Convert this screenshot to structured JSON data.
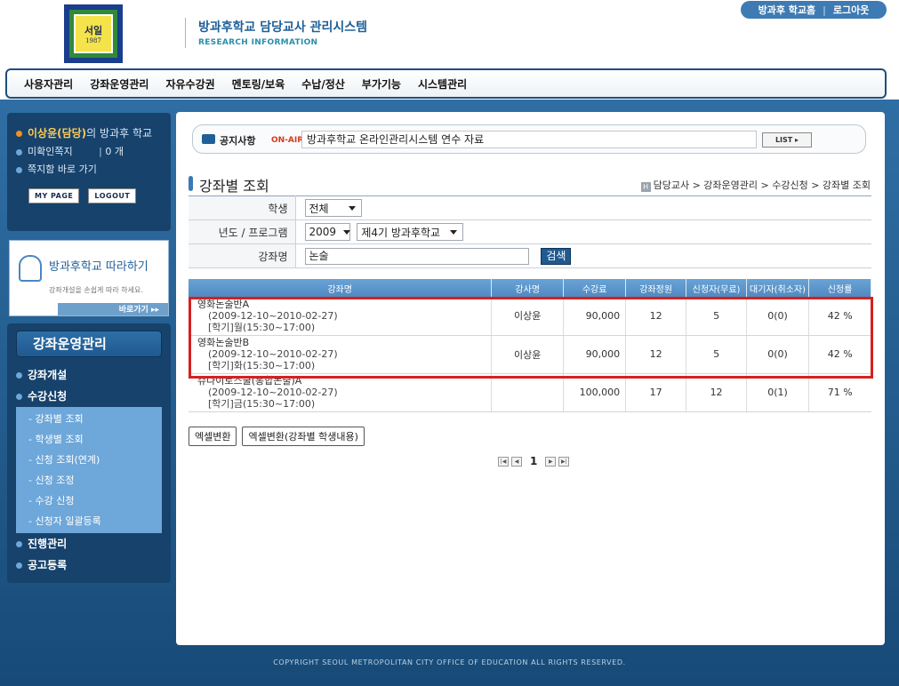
{
  "header": {
    "logo_text": "서일",
    "logo_year": "1987",
    "title": "방과후학교 담당교사 관리시스템",
    "subtitle": "RESEARCH INFORMATION",
    "links": [
      "방과후 학교홈",
      "로그아웃"
    ]
  },
  "gnb": [
    "사용자관리",
    "강좌운영관리",
    "자유수강권",
    "멘토링/보육",
    "수납/정산",
    "부가기능",
    "시스템관리"
  ],
  "user": {
    "name": "이상윤(담당)",
    "name_suffix": "의 방과후 학교",
    "unread_label": "미확인쪽지",
    "unread_count": "0 개",
    "inbox_label": "쪽지함 바로 가기",
    "mypage_btn": "MY PAGE",
    "logout_btn": "LOGOUT"
  },
  "banner": {
    "title": "방과후학교 따라하기",
    "subtitle": "강좌개설을 손쉽게 따라 하세요.",
    "go": "바로가기 ▸▸"
  },
  "lnb": {
    "title": "강좌운영관리",
    "items": [
      "강좌개설",
      "수강신청",
      "진행관리",
      "공고등록"
    ],
    "sub_items": [
      "- 강좌별 조회",
      "- 학생별 조회",
      "- 신청 조회(연계)",
      "- 신청 조정",
      "- 수강 신청",
      "- 신청자 일괄등록"
    ]
  },
  "notice": {
    "label": "공지사항",
    "onair": "ON-AIR",
    "text": "방과후학교 온라인관리시스템 연수 자료",
    "list_btn": "LIST ▸"
  },
  "page": {
    "title": "강좌별 조회",
    "breadcrumb": "담당교사 > 강좌운영관리 > 수강신청 > 강좌별 조회",
    "breadcrumb_icon": "H"
  },
  "search": {
    "student_label": "학생",
    "student_value": "전체",
    "year_label": "년도 / 프로그램",
    "year_value": "2009",
    "program_value": "제4기 방과후학교",
    "course_label": "강좌명",
    "course_value": "논술",
    "search_btn": "검색"
  },
  "table": {
    "headers": [
      "강좌명",
      "강사명",
      "수강료",
      "강좌정원",
      "신청자(무료)",
      "대기자(취소자)",
      "신청률"
    ],
    "rows": [
      {
        "name": "영화논술반A",
        "period": "(2009-12-10~2010-02-27)",
        "time": "[학기]월(15:30~17:00)",
        "teacher": "이상윤",
        "fee": "90,000",
        "capacity": "12",
        "applicants": "5",
        "waiting": "0(0)",
        "rate": "42 %"
      },
      {
        "name": "영화논술반B",
        "period": "(2009-12-10~2010-02-27)",
        "time": "[학기]화(15:30~17:00)",
        "teacher": "이상윤",
        "fee": "90,000",
        "capacity": "12",
        "applicants": "5",
        "waiting": "0(0)",
        "rate": "42 %"
      },
      {
        "name": "슈나이로스쿨(통합논술)A",
        "period": "(2009-12-10~2010-02-27)",
        "time": "[학기]금(15:30~17:00)",
        "teacher": "",
        "fee": "100,000",
        "capacity": "17",
        "applicants": "12",
        "waiting": "0(1)",
        "rate": "71 %"
      }
    ]
  },
  "buttons": {
    "excel": "엑셀변환",
    "excel_students": "엑셀변환(강좌별 학생내용)"
  },
  "pager": {
    "current": "1"
  },
  "footer": "COPYRIGHT SEOUL METROPOLITAN CITY OFFICE OF EDUCATION ALL RIGHTS RESERVED.",
  "colors": {
    "highlight": "#d62020",
    "brand": "#1f5f98"
  }
}
